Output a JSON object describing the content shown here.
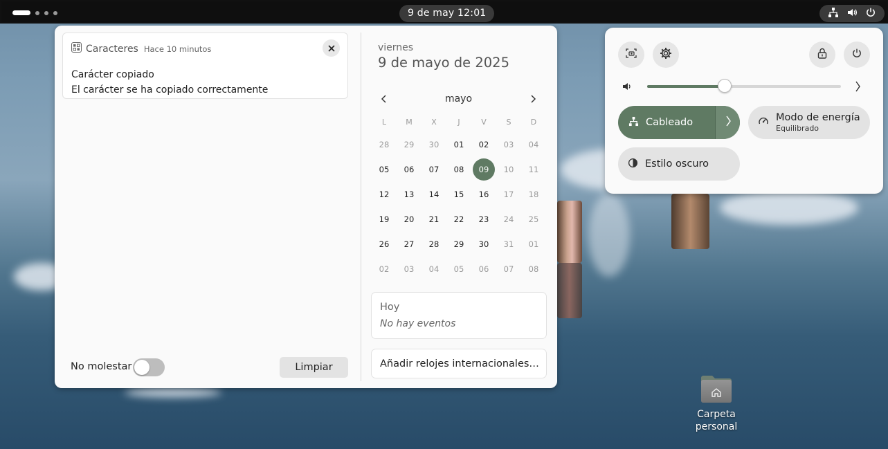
{
  "topbar": {
    "clock": "9 de may  12:01"
  },
  "notification": {
    "app_name": "Caracteres",
    "time": "Hace 10 minutos",
    "title": "Carácter copiado",
    "body": "El carácter se ha copiado correctamente"
  },
  "footer": {
    "dnd_label": "No molestar",
    "dnd_enabled": false,
    "clear_label": "Limpiar"
  },
  "calendar": {
    "weekday": "viernes",
    "full_date": "9 de mayo de 2025",
    "month": "mayo",
    "days_of_week": [
      "L",
      "M",
      "X",
      "J",
      "V",
      "S",
      "D"
    ],
    "weeks": [
      [
        "28",
        "29",
        "30",
        "01",
        "02",
        "03",
        "04"
      ],
      [
        "05",
        "06",
        "07",
        "08",
        "09",
        "10",
        "11"
      ],
      [
        "12",
        "13",
        "14",
        "15",
        "16",
        "17",
        "18"
      ],
      [
        "19",
        "20",
        "21",
        "22",
        "23",
        "24",
        "25"
      ],
      [
        "26",
        "27",
        "28",
        "29",
        "30",
        "31",
        "01"
      ],
      [
        "02",
        "03",
        "04",
        "05",
        "06",
        "07",
        "08"
      ]
    ],
    "today": "09",
    "accent_color": "#5f7a63"
  },
  "events": {
    "heading": "Hoy",
    "empty_text": "No hay eventos"
  },
  "world_clocks": {
    "label": "Añadir relojes internacionales…"
  },
  "quick_settings": {
    "volume_level": 0.4,
    "wired_label": "Cableado",
    "power_mode_label": "Modo de energía",
    "power_mode_value": "Equilibrado",
    "dark_style_label": "Estilo oscuro"
  },
  "desktop": {
    "home_folder_line1": "Carpeta",
    "home_folder_line2": "personal"
  }
}
